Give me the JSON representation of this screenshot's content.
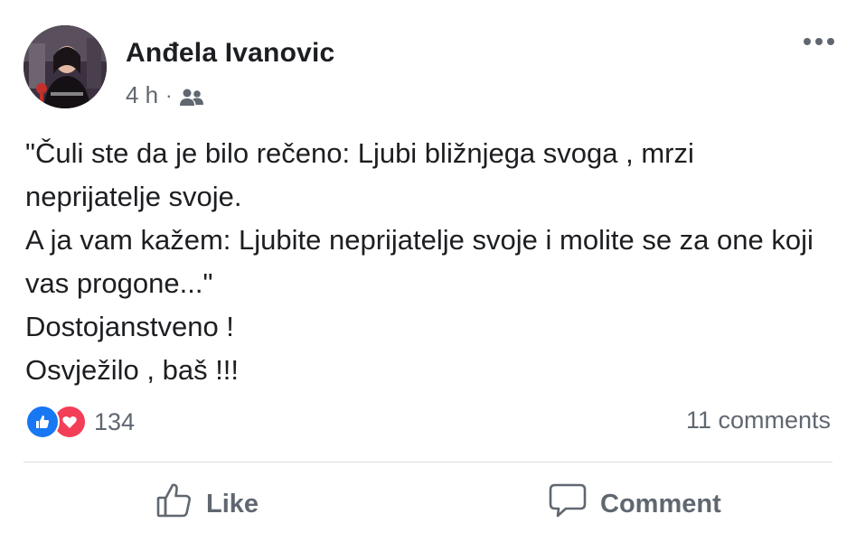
{
  "post": {
    "author": "Anđela Ivanovic",
    "time": "4 h",
    "separator": "·",
    "audience_icon": "friends-icon",
    "more_icon": "more-options-icon",
    "text_lines": [
      "\"Čuli ste da je bilo rečeno: Ljubi bližnjega svoga , mrzi neprijatelje svoje.",
      "A ja vam kažem: Ljubite neprijatelje svoje i molite se za one koji vas progone...\"",
      "Dostojanstveno !",
      "Osvježilo , baš !!!"
    ]
  },
  "stats": {
    "reactions_count": "134",
    "reaction_icons": [
      "like-reaction-icon",
      "love-reaction-icon"
    ],
    "comments": "11 comments"
  },
  "actions": {
    "like_label": "Like",
    "comment_label": "Comment"
  },
  "colors": {
    "like_blue": "#1877f2",
    "love_red": "#f33e58",
    "secondary_text": "#606770",
    "primary_text": "#1c1e21"
  }
}
